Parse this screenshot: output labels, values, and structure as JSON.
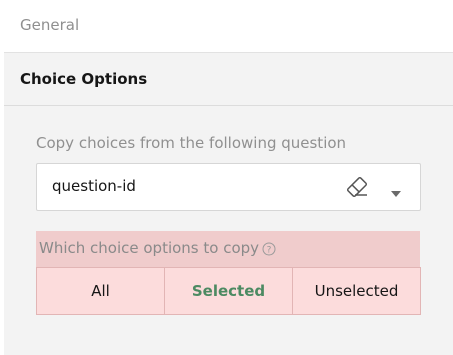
{
  "sections": {
    "general_label": "General",
    "choice_options_label": "Choice Options"
  },
  "copy_choices": {
    "label": "Copy choices from the following question",
    "dropdown_value": "question-id",
    "clear_icon": "eraser-icon",
    "expand_icon": "chevron-down-icon"
  },
  "which_options": {
    "label": "Which choice options to copy",
    "help_icon": "help-circle-icon",
    "options": [
      {
        "label": "All"
      },
      {
        "label": "Selected"
      },
      {
        "label": "Unselected"
      }
    ],
    "selected_option": "Selected"
  },
  "colors": {
    "highlight_bar": "#f0cccc",
    "segment_background": "#fcdcdc",
    "selected_text": "#4c8a62"
  }
}
